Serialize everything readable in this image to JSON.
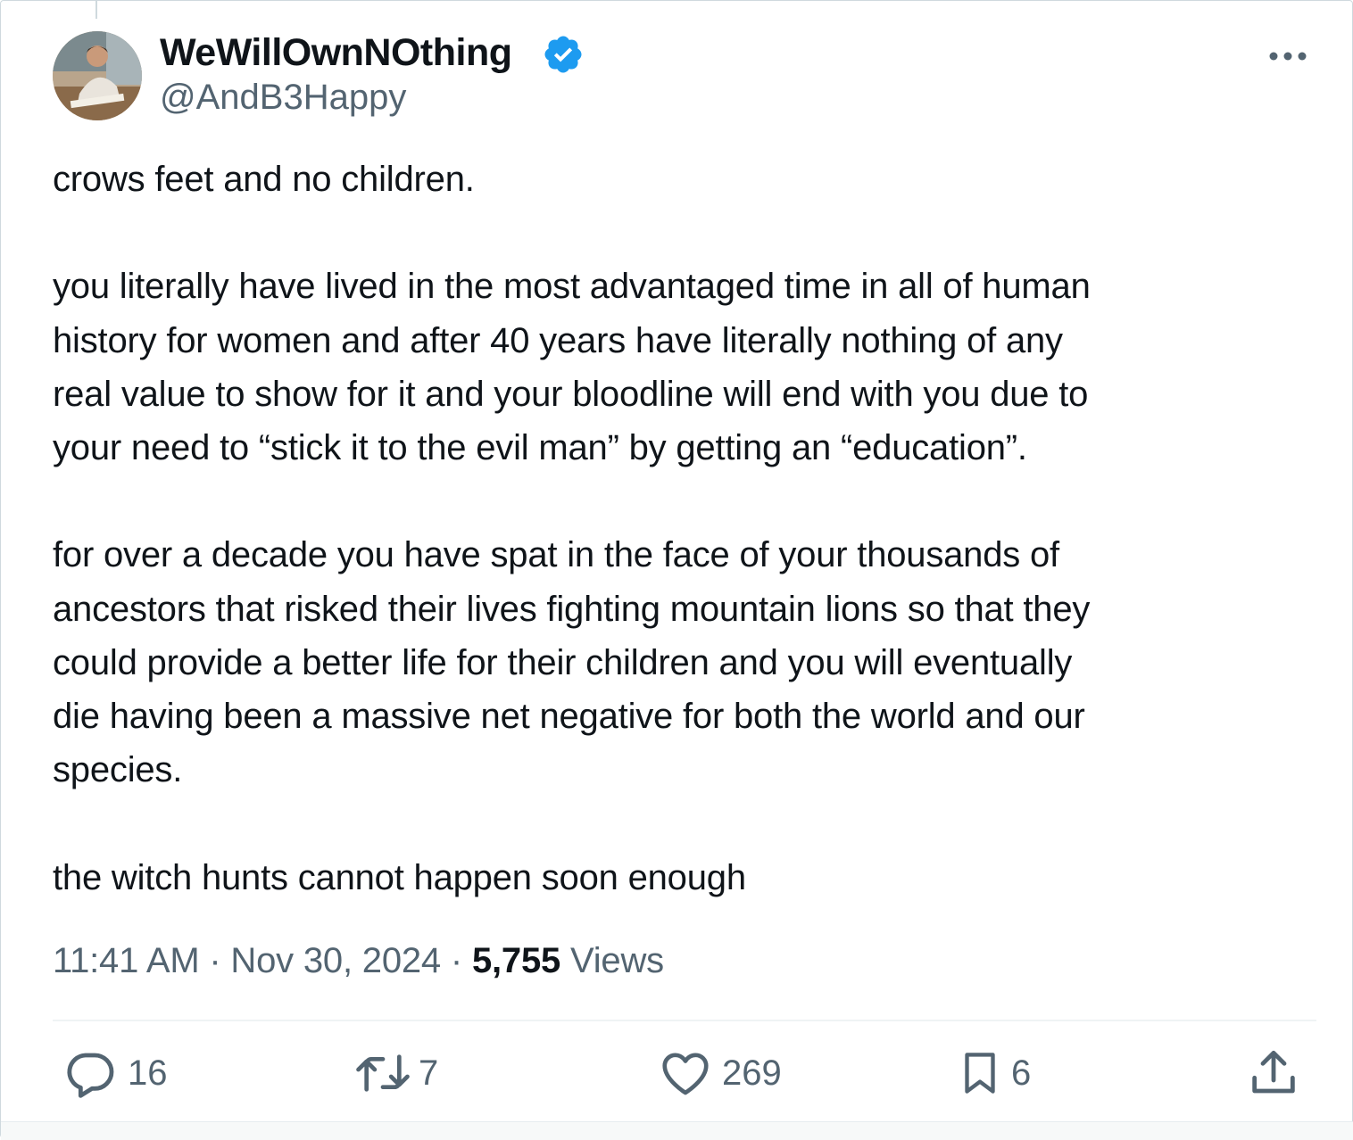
{
  "author": {
    "display_name": "WeWillOwnNOthing",
    "handle": "@AndB3Happy",
    "verified": true,
    "verified_color": "#1d9bf0"
  },
  "tweet": {
    "paragraphs": [
      [
        "crows feet and no children."
      ],
      [
        "you literally have lived in the most advantaged time in all of human",
        "history for women and after 40 years have literally nothing of any",
        "real value to show for it and your bloodline will end with you due to",
        "your need to “stick it to the evil man” by getting an “education”."
      ],
      [
        "for over a decade you have spat in the face of your thousands of",
        "ancestors that risked their lives fighting mountain lions so that they",
        "could provide a better life for their children and you will eventually",
        "die having been a massive net negative for both the world and our",
        "species."
      ],
      [
        "the witch hunts cannot happen soon enough"
      ]
    ]
  },
  "meta": {
    "time": "11:41 AM",
    "separator": "·",
    "date": "Nov 30, 2024",
    "views_count": "5,755",
    "views_label": "Views"
  },
  "actions": {
    "replies": "16",
    "reposts": "7",
    "likes": "269",
    "bookmarks": "6"
  },
  "icons": {
    "more": "more-horizontal-icon",
    "reply": "reply-icon",
    "repost": "repost-icon",
    "like": "heart-icon",
    "bookmark": "bookmark-icon",
    "share": "share-icon",
    "verified": "verified-badge-icon"
  },
  "colors": {
    "text_primary": "#0f1419",
    "text_secondary": "#536471",
    "divider": "#eff3f4"
  }
}
